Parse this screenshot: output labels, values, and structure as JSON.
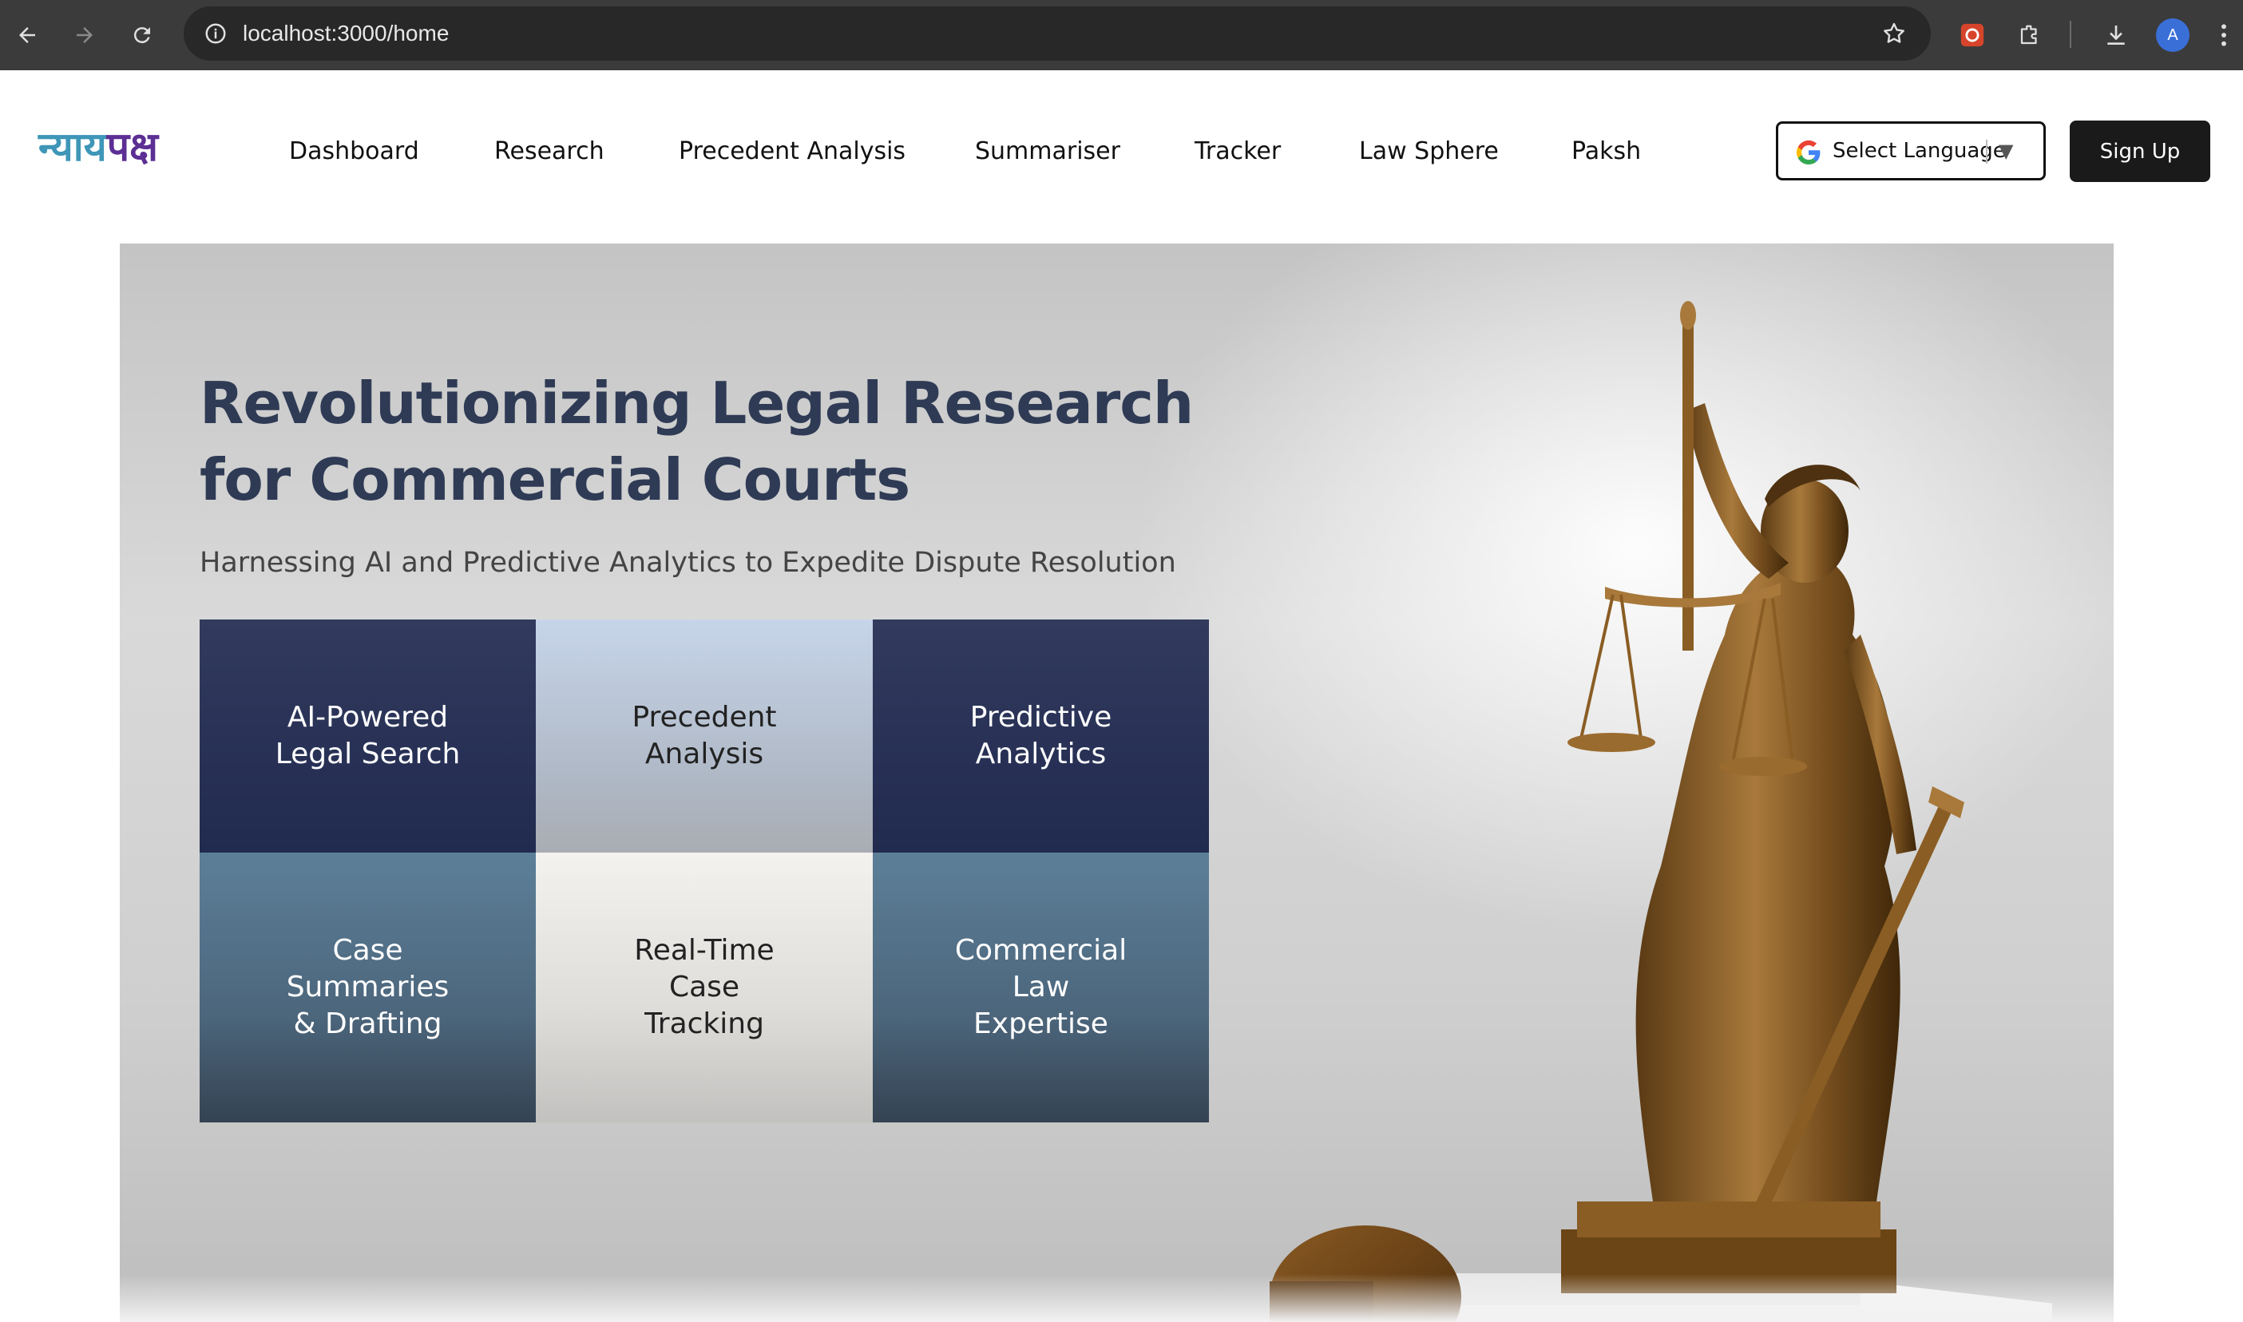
{
  "browser": {
    "url": "localhost:3000/home",
    "profile_initial": "A",
    "icons": [
      "back-arrow-icon",
      "forward-arrow-icon",
      "reload-icon",
      "site-info-icon",
      "bookmark-star-icon",
      "extension-icon",
      "puzzle-icon",
      "download-icon",
      "kebab-menu-icon"
    ]
  },
  "site": {
    "logo": {
      "part1": "न्याय",
      "part2": "पक्ष"
    },
    "nav": [
      {
        "label": "Dashboard"
      },
      {
        "label": "Research"
      },
      {
        "label": "Precedent Analysis"
      },
      {
        "label": "Summariser"
      },
      {
        "label": "Tracker"
      },
      {
        "label": "Law Sphere"
      },
      {
        "label": "Paksh"
      }
    ],
    "language_select": "Select Language",
    "signup": "Sign Up"
  },
  "hero": {
    "title": "Revolutionizing Legal Research for Commercial Courts",
    "subtitle": "Harnessing AI and Predictive Analytics to Expedite Dispute Resolution",
    "tiles": [
      {
        "label": "AI-Powered\nLegal Search"
      },
      {
        "label": "Precedent\nAnalysis"
      },
      {
        "label": "Predictive\nAnalytics"
      },
      {
        "label": "Case\nSummaries\n& Drafting"
      },
      {
        "label": "Real-Time\nCase\nTracking"
      },
      {
        "label": "Commercial\nLaw\nExpertise"
      }
    ]
  },
  "colors": {
    "brand_purple": "#5c2f94",
    "brand_teal": "#3e96b8",
    "title_navy": "#2f3b55",
    "tile_dark": "#2a3358",
    "tile_steel": "#56788f"
  }
}
